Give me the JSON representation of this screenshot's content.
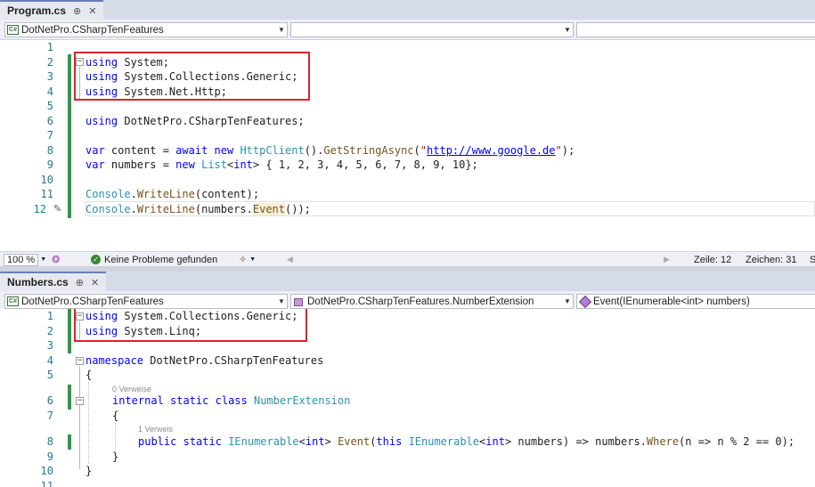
{
  "top": {
    "tab": {
      "title": "Program.cs",
      "pin": "⊕",
      "close": "✕"
    },
    "nav": {
      "project": "DotNetPro.CSharpTenFeatures",
      "type": "",
      "member": ""
    },
    "lines": [
      {
        "n": "1"
      },
      {
        "n": "2"
      },
      {
        "n": "3"
      },
      {
        "n": "4"
      },
      {
        "n": "5"
      },
      {
        "n": "6"
      },
      {
        "n": "7"
      },
      {
        "n": "8"
      },
      {
        "n": "9"
      },
      {
        "n": "10"
      },
      {
        "n": "11"
      },
      {
        "n": "12"
      }
    ],
    "code": {
      "l2_kw": "using",
      "l2_rest": " System;",
      "l3_kw": "using",
      "l3_rest": " System.Collections.Generic;",
      "l4_kw": "using",
      "l4_rest": " System.Net.Http;",
      "l6_kw": "using",
      "l6_rest": " DotNetPro.CSharpTenFeatures;",
      "l8_var": "var",
      "l8_a": " content = ",
      "l8_await": "await",
      "l8_sp": " ",
      "l8_new": "new",
      "l8_sp2": " ",
      "l8_type": "HttpClient",
      "l8_b": "().",
      "l8_method": "GetStringAsync",
      "l8_c": "(",
      "l8_q1": "\"",
      "l8_url": "http://www.google.de",
      "l8_q2": "\"",
      "l8_d": ");",
      "l9_var": "var",
      "l9_a": " numbers = ",
      "l9_new": "new",
      "l9_sp": " ",
      "l9_type": "List",
      "l9_b": "<",
      "l9_int": "int",
      "l9_c": "> { 1, 2, 3, 4, 5, 6, 7, 8, 9, 10};",
      "l11_type": "Console",
      "l11_dot": ".",
      "l11_method": "WriteLine",
      "l11_rest": "(content);",
      "l12_type": "Console",
      "l12_dot": ".",
      "l12_method": "WriteLine",
      "l12_a": "(numbers.",
      "l12_event": "Event",
      "l12_rest": "());"
    },
    "status": {
      "zoom": "100 %",
      "problems": "Keine Probleme gefunden",
      "line": "Zeile: 12",
      "chars": "Zeichen: 31",
      "s": "S"
    }
  },
  "bottom": {
    "tab": {
      "title": "Numbers.cs",
      "pin": "⊕",
      "close": "✕"
    },
    "nav": {
      "project": "DotNetPro.CSharpTenFeatures",
      "type": "DotNetPro.CSharpTenFeatures.NumberExtension",
      "member": "Event(IEnumerable<int> numbers)"
    },
    "lines": [
      {
        "n": "1"
      },
      {
        "n": "2"
      },
      {
        "n": "3"
      },
      {
        "n": "4"
      },
      {
        "n": "5"
      },
      {
        "n": "6"
      },
      {
        "n": "7"
      },
      {
        "n": "8"
      },
      {
        "n": "9"
      },
      {
        "n": "10"
      },
      {
        "n": "11"
      }
    ],
    "hints": {
      "refs0": "0 Verweise",
      "refs1": "1 Verweis"
    },
    "code": {
      "l1_kw": "using",
      "l1_rest": " System.Collections.Generic;",
      "l2_kw": "using",
      "l2_rest": " System.Linq;",
      "l4_kw": "namespace",
      "l4_rest": " DotNetPro.CSharpTenFeatures",
      "l5": "{",
      "l6_internal": "internal",
      "l6_static": "static",
      "l6_class": "class",
      "l6_name": "NumberExtension",
      "l7": "{",
      "l8_public": "public",
      "l8_static": "static",
      "l8_type": "IEnumerable",
      "l8_lt": "<",
      "l8_int": "int",
      "l8_gt": ">",
      "l8_method": "Event",
      "l8_a": "(",
      "l8_this": "this",
      "l8_type2": "IEnumerable",
      "l8_lt2": "<",
      "l8_int2": "int",
      "l8_b": "> numbers) => numbers.",
      "l8_where": "Where",
      "l8_c": "(n => n % 2 == 0);",
      "l9": "}",
      "l10": "}"
    }
  }
}
